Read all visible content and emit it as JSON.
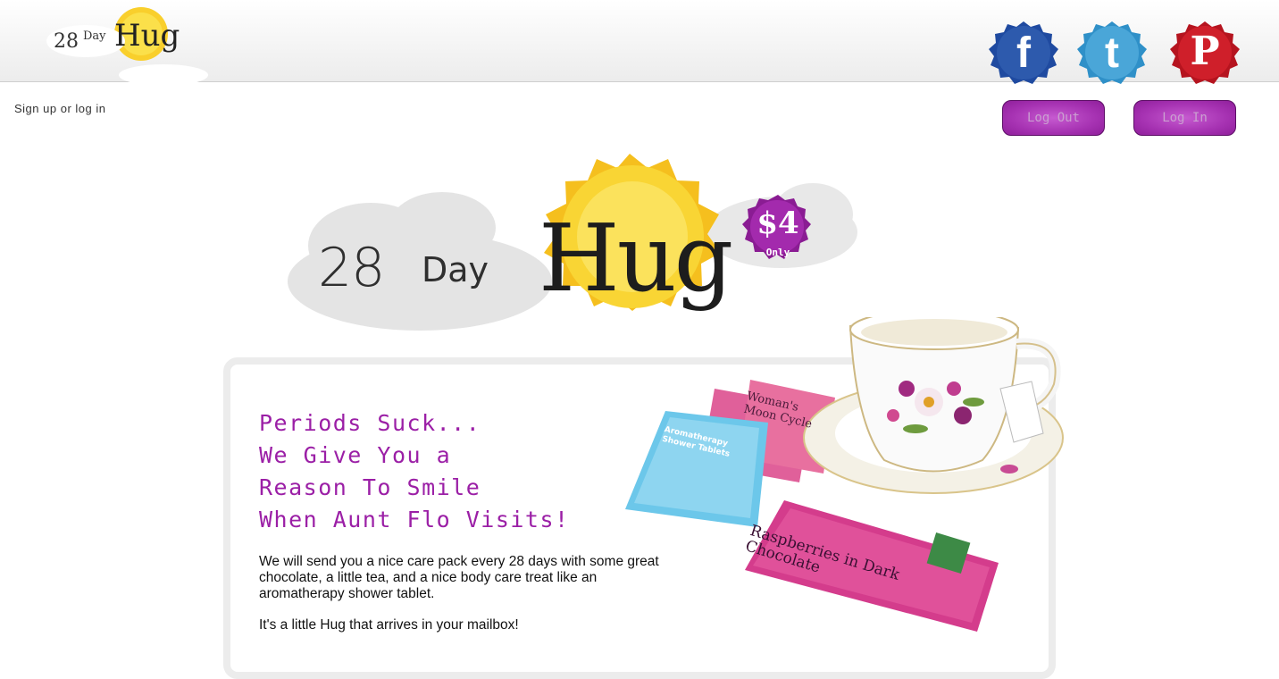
{
  "header": {
    "logo": {
      "num": "28",
      "day": "Day",
      "hug": "Hug"
    },
    "social": [
      {
        "name": "facebook",
        "glyph": "f",
        "color": "#2d5aad"
      },
      {
        "name": "twitter",
        "glyph": "t",
        "color": "#4aa6d8"
      },
      {
        "name": "pinterest",
        "glyph": "P",
        "color": "#cf1f2a"
      }
    ]
  },
  "auth": {
    "signup_text": "Sign up",
    "or_text": "or",
    "login_text": "log in",
    "logout_button": "Log Out",
    "login_button": "Log In"
  },
  "hero": {
    "num": "28",
    "day": "Day",
    "hug": "Hug",
    "price": "$4",
    "price_sub": "Only"
  },
  "content": {
    "tagline": [
      "Periods Suck...",
      "We Give You a",
      "Reason To Smile",
      "When Aunt Flo Visits!"
    ],
    "description": "We will send you a nice care pack every 28 days with some great chocolate, a little tea, and a nice body care treat like an aromatherapy shower tablet.",
    "closing": "It's a little Hug that arrives in your mailbox!",
    "product_labels": {
      "chocolate": "Raspberries in Dark Chocolate",
      "tea": "Woman's Moon Cycle",
      "tablet": "Aromatherapy Shower Tablets"
    }
  },
  "colors": {
    "accent": "#9b1fa6",
    "button": "#a632b2",
    "sun": "#f7c726"
  }
}
